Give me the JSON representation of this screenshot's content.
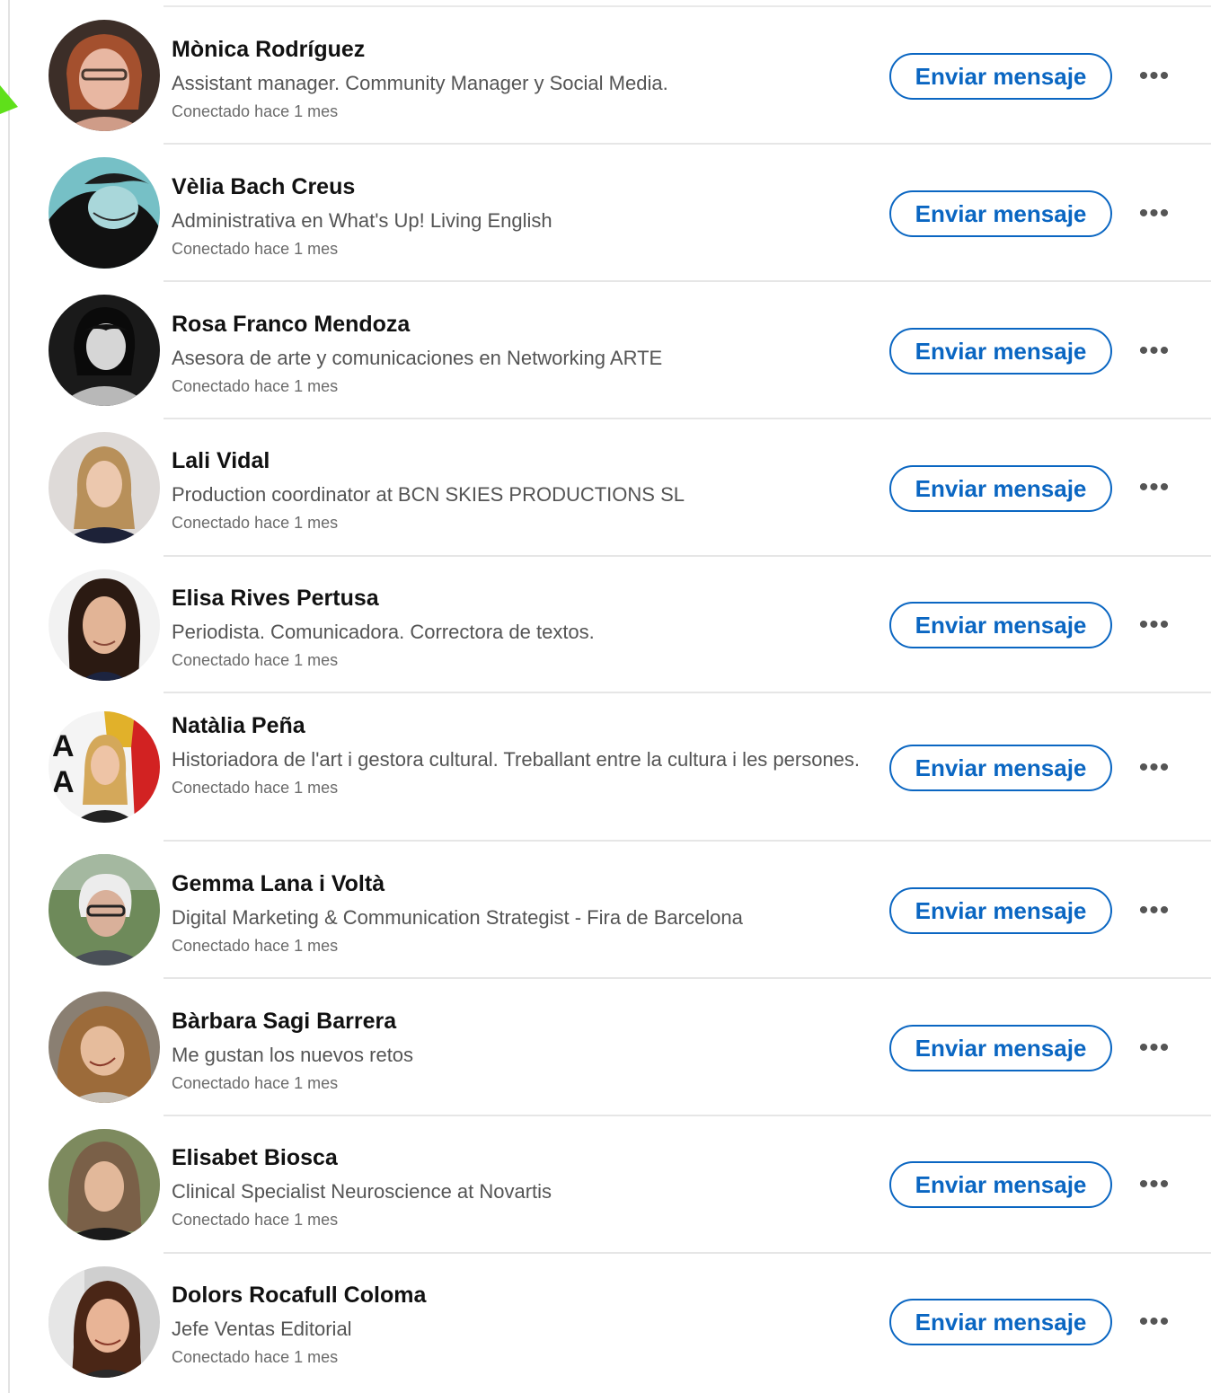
{
  "accent_color": "#0a66c2",
  "connections": [
    {
      "name": "Mònica Rodríguez",
      "headline": "Assistant manager. Community Manager y Social Media.",
      "connected": "Conectado hace 1 mes",
      "message_label": "Enviar mensaje",
      "more_icon": "ellipsis-icon"
    },
    {
      "name": "Vèlia Bach Creus",
      "headline": "Administrativa en What's Up! Living English",
      "connected": "Conectado hace 1 mes",
      "message_label": "Enviar mensaje",
      "more_icon": "ellipsis-icon"
    },
    {
      "name": "Rosa Franco Mendoza",
      "headline": "Asesora de arte y comunicaciones en Networking ARTE",
      "connected": "Conectado hace 1 mes",
      "message_label": "Enviar mensaje",
      "more_icon": "ellipsis-icon"
    },
    {
      "name": "Lali Vidal",
      "headline": "Production coordinator at BCN SKIES PRODUCTIONS SL",
      "connected": "Conectado hace 1 mes",
      "message_label": "Enviar mensaje",
      "more_icon": "ellipsis-icon"
    },
    {
      "name": "Elisa Rives Pertusa",
      "headline": "Periodista. Comunicadora. Correctora de textos.",
      "connected": "Conectado hace 1 mes",
      "message_label": "Enviar mensaje",
      "more_icon": "ellipsis-icon"
    },
    {
      "name": "Natàlia Peña",
      "headline": "Historiadora de l'art i gestora cultural. Treballant entre la cultura i les persones.",
      "connected": "Conectado hace 1 mes",
      "message_label": "Enviar mensaje",
      "more_icon": "ellipsis-icon"
    },
    {
      "name": "Gemma Lana i Voltà",
      "headline": "Digital Marketing & Communication Strategist - Fira de Barcelona",
      "connected": "Conectado hace 1 mes",
      "message_label": "Enviar mensaje",
      "more_icon": "ellipsis-icon"
    },
    {
      "name": "Bàrbara Sagi Barrera",
      "headline": "Me gustan los nuevos retos",
      "connected": "Conectado hace 1 mes",
      "message_label": "Enviar mensaje",
      "more_icon": "ellipsis-icon"
    },
    {
      "name": "Elisabet Biosca",
      "headline": "Clinical Specialist Neuroscience at Novartis",
      "connected": "Conectado hace 1 mes",
      "message_label": "Enviar mensaje",
      "more_icon": "ellipsis-icon"
    },
    {
      "name": "Dolors Rocafull Coloma",
      "headline": "Jefe Ventas Editorial",
      "connected": "Conectado hace 1 mes",
      "message_label": "Enviar mensaje",
      "more_icon": "ellipsis-icon"
    }
  ]
}
